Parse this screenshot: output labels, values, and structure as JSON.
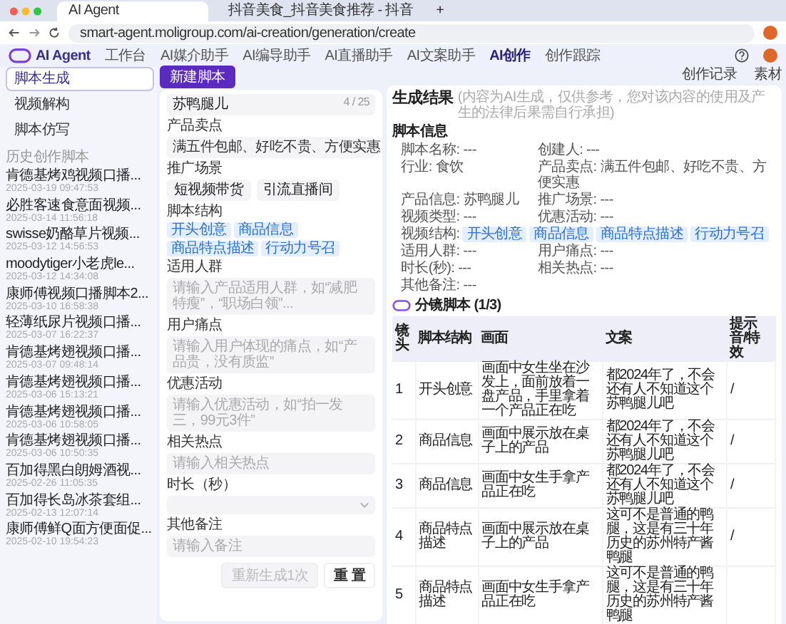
{
  "browser": {
    "tabs": [
      {
        "title": "AI Agent",
        "selected": true
      },
      {
        "title": "抖音美食_抖音美食推荐 - 抖音",
        "selected": false
      }
    ],
    "new_tab": "+",
    "url": "smart-agent.moligroup.com/ai-creation/generation/create"
  },
  "header": {
    "brand": "AI Agent",
    "nav": [
      {
        "label": "工作台",
        "selected": false
      },
      {
        "label": "AI媒介助手",
        "selected": false
      },
      {
        "label": "AI编导助手",
        "selected": false
      },
      {
        "label": "AI直播助手",
        "selected": false
      },
      {
        "label": "AI文案助手",
        "selected": false
      },
      {
        "label": "AI创作",
        "selected": true
      },
      {
        "label": "创作跟踪",
        "selected": false
      }
    ]
  },
  "toolbar": {
    "new_button": "新建脚本",
    "links": [
      "创作记录",
      "素材"
    ]
  },
  "sidebar": {
    "items": [
      {
        "label": "脚本生成",
        "selected": true
      },
      {
        "label": "视频解构",
        "selected": false
      },
      {
        "label": "脚本仿写",
        "selected": false
      }
    ],
    "history_title": "历史创作脚本",
    "history": [
      {
        "title": "肯德基烤鸡视频口播...",
        "time": "2025-03-19 09:47:53"
      },
      {
        "title": "必胜客速食意面视频...",
        "time": "2025-03-14 11:56:18"
      },
      {
        "title": "swisse奶酪草片视频...",
        "time": "2025-03-12 14:56:53"
      },
      {
        "title": "moodytiger小老虎le...",
        "time": "2025-03-12 14:34:08"
      },
      {
        "title": "康师傅视频口播脚本2...",
        "time": "2025-03-10 16:58:38"
      },
      {
        "title": "轻薄纸尿片视频口播...",
        "time": "2025-03-07 16:22:37"
      },
      {
        "title": "肯德基烤翅视频口播...",
        "time": "2025-03-07 09:48:14"
      },
      {
        "title": "肯德基烤翅视频口播...",
        "time": "2025-03-06 15:13:21"
      },
      {
        "title": "肯德基烤翅视频口播...",
        "time": "2025-03-06 10:58:05"
      },
      {
        "title": "肯德基烤翅视频口播...",
        "time": "2025-03-06 10:50:35"
      },
      {
        "title": "百加得黑白朗姆酒视...",
        "time": "2025-02-26 11:05:35"
      },
      {
        "title": "百加得长岛冰茶套组...",
        "time": "2025-02-13 12:07:14"
      },
      {
        "title": "康师傅鲜Q面方便面促...",
        "time": "2025-02-10 19:54:23"
      }
    ]
  },
  "form": {
    "name_value": "苏鸭腿儿",
    "name_count": "4 / 25",
    "selling_label": "产品卖点",
    "selling_tag": "满五件包邮、好吃不贵、方便实惠",
    "scene_label": "推广场景",
    "scene_options": [
      "短视频带货",
      "引流直播间"
    ],
    "structure_label": "脚本结构",
    "structure_tags": [
      "开头创意",
      "商品信息",
      "商品特点描述",
      "行动力号召"
    ],
    "fields": [
      {
        "label": "适用人群",
        "kind": "input",
        "placeholder": "请输入产品适用人群，如“减肥特瘦”，“职场白领”..."
      },
      {
        "label": "用户痛点",
        "kind": "input",
        "placeholder": "请输入用户体现的痛点，如“产品贵，没有质监”"
      },
      {
        "label": "优惠活动",
        "kind": "input",
        "placeholder": "请输入优惠活动，如“拍一发三，99元3件”"
      },
      {
        "label": "相关热点",
        "kind": "input",
        "placeholder": "请输入相关热点"
      },
      {
        "label": "时长（秒）",
        "kind": "select"
      },
      {
        "label": "其他备注",
        "kind": "input",
        "placeholder": "请输入备注"
      }
    ],
    "regenerate": {
      "label": "重新生成1次",
      "disabled": true
    },
    "reset": "重 置"
  },
  "result": {
    "title": "生成结果",
    "note": "(内容为AI生成，仅供参考，您对该内容的使用及产生的法律后果需自行承担)",
    "info_title": "脚本信息",
    "info": [
      {
        "kind": "text",
        "text": "脚本名称: ---"
      },
      {
        "kind": "text",
        "text": "创建人: ---"
      },
      {
        "kind": "text",
        "text": "行业: 食饮"
      },
      {
        "kind": "text",
        "text": "产品卖点: 满五件包邮、好吃不贵、方便实惠"
      },
      {
        "kind": "text",
        "text": "产品信息: 苏鸭腿儿"
      },
      {
        "kind": "text",
        "text": "推广场景: ---"
      },
      {
        "kind": "text",
        "text": "视频类型: ---"
      },
      {
        "kind": "text",
        "text": "优惠活动: ---"
      },
      {
        "kind": "tags",
        "label": "视频结构:",
        "tags": [
          "开头创意",
          "商品信息",
          "商品特点描述",
          "行动力号召"
        ]
      },
      {
        "kind": "text",
        "text": "适用人群: ---"
      },
      {
        "kind": "text",
        "text": "用户痛点: ---"
      },
      {
        "kind": "text",
        "text": "时长(秒): ---"
      },
      {
        "kind": "text",
        "text": "相关热点: ---"
      },
      {
        "kind": "text",
        "text": "其他备注: ---"
      }
    ],
    "storyboard_title": "分镜脚本 (1/3)",
    "columns": [
      "镜头",
      "脚本结构",
      "画面",
      "文案",
      "提示音/特效"
    ],
    "rows": [
      [
        "1",
        "开头创意",
        "画面中女生坐在沙发上，面前放着一盘产品，手里拿着一个产品正在吃",
        "都2024年了，不会还有人不知道这个苏鸭腿儿吧",
        "/"
      ],
      [
        "2",
        "商品信息",
        "画面中展示放在桌子上的产品",
        "都2024年了，不会还有人不知道这个苏鸭腿儿吧",
        "/"
      ],
      [
        "3",
        "商品信息",
        "画面中女生手拿产品正在吃",
        "都2024年了，不会还有人不知道这个苏鸭腿儿吧",
        "/"
      ],
      [
        "4",
        "商品特点描述",
        "画面中展示放在桌子上的产品",
        "这可不是普通的鸭腿，这是有三十年历史的苏州特产酱鸭腿",
        "/"
      ],
      [
        "5",
        "商品特点描述",
        "画面中女生手拿产品正在吃",
        "这可不是普通的鸭腿，这是有三十年历史的苏州特产酱鸭腿",
        ""
      ]
    ]
  }
}
